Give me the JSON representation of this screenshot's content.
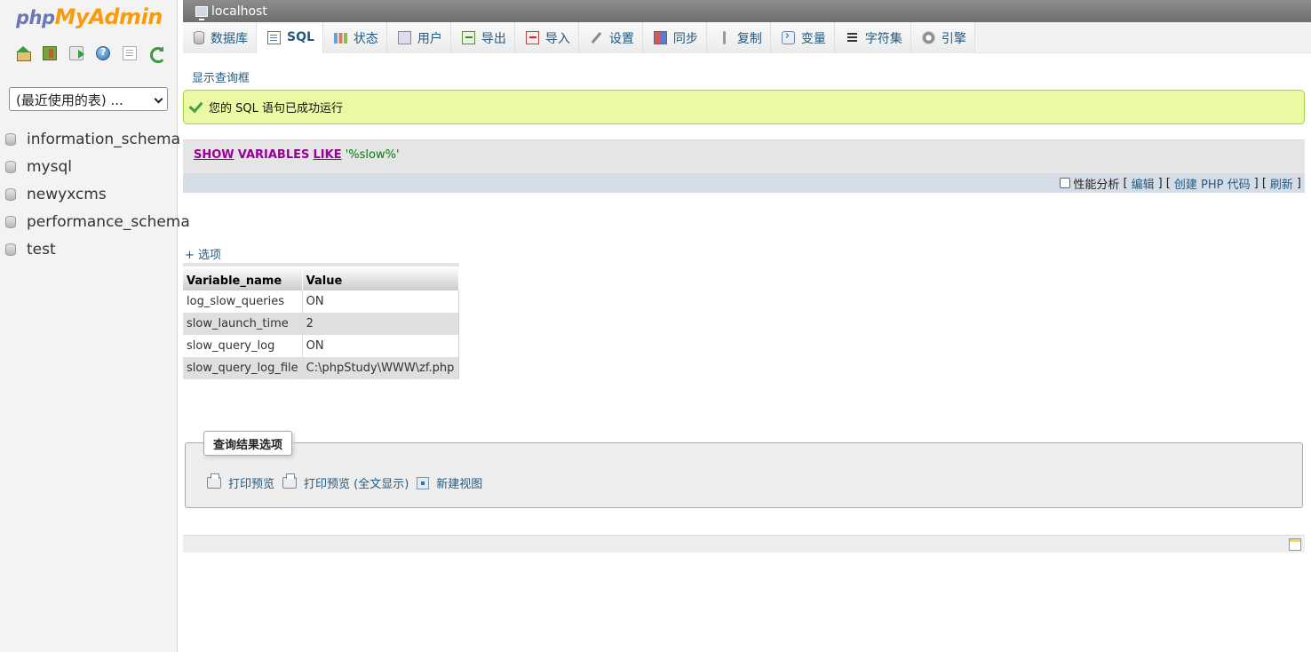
{
  "navigation": {
    "logo": {
      "part1": "php",
      "part2": "MyAdmin"
    },
    "icons": [
      "home-icon",
      "exit-icon",
      "query-window-icon",
      "help-icon",
      "docs-icon",
      "reload-icon"
    ],
    "recent_tables": "(最近使用的表) ...",
    "databases": [
      "information_schema",
      "mysql",
      "newyxcms",
      "performance_schema",
      "test"
    ]
  },
  "server_bar": {
    "label": "localhost"
  },
  "tabs": [
    {
      "label": "数据库",
      "icon": "database-icon"
    },
    {
      "label": "SQL",
      "icon": "sql-icon",
      "active": true
    },
    {
      "label": "状态",
      "icon": "status-icon"
    },
    {
      "label": "用户",
      "icon": "users-icon"
    },
    {
      "label": "导出",
      "icon": "export-icon"
    },
    {
      "label": "导入",
      "icon": "import-icon"
    },
    {
      "label": "设置",
      "icon": "settings-icon"
    },
    {
      "label": "同步",
      "icon": "sync-icon"
    },
    {
      "label": "复制",
      "icon": "replication-icon"
    },
    {
      "label": "变量",
      "icon": "variables-icon"
    },
    {
      "label": "字符集",
      "icon": "charset-icon"
    },
    {
      "label": "引擎",
      "icon": "engines-icon"
    }
  ],
  "main": {
    "show_query_box": "显示查询框",
    "success_message": "您的 SQL 语句已成功运行",
    "sql": {
      "kw1": "SHOW",
      "kw2": "VARIABLES",
      "kw3": "LIKE",
      "str": "'%slow%'"
    },
    "sql_links": {
      "profiling": "性能分析",
      "edit": "编辑",
      "create_php": "创建 PHP 代码",
      "refresh": "刷新"
    },
    "options_link": "+ 选项",
    "table": {
      "headers": [
        "Variable_name",
        "Value"
      ],
      "rows": [
        [
          "log_slow_queries",
          "ON"
        ],
        [
          "slow_launch_time",
          "2"
        ],
        [
          "slow_query_log",
          "ON"
        ],
        [
          "slow_query_log_file",
          "C:\\phpStudy\\WWW\\zf.php"
        ]
      ]
    },
    "query_results_options": {
      "legend": "查询结果选项",
      "print_view": "打印预览",
      "print_view_full": "打印预览 (全文显示)",
      "create_view": "新建视图"
    }
  },
  "colors": {
    "link": "#235a81",
    "success_bg": "#ebf8a4",
    "sql_keyword": "#990099",
    "sql_string": "#008000"
  }
}
